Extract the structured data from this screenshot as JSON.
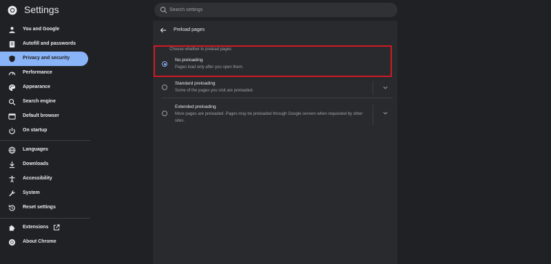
{
  "header": {
    "title": "Settings",
    "search_placeholder": "Search settings"
  },
  "sidebar": {
    "items": [
      {
        "label": "You and Google",
        "icon": "person-icon"
      },
      {
        "label": "Autofill and passwords",
        "icon": "autofill-icon"
      },
      {
        "label": "Privacy and security",
        "icon": "shield-icon",
        "active": true
      },
      {
        "label": "Performance",
        "icon": "speedometer-icon"
      },
      {
        "label": "Appearance",
        "icon": "palette-icon"
      },
      {
        "label": "Search engine",
        "icon": "search-icon"
      },
      {
        "label": "Default browser",
        "icon": "browser-icon"
      },
      {
        "label": "On startup",
        "icon": "power-icon"
      },
      {
        "label": "Languages",
        "icon": "globe-icon"
      },
      {
        "label": "Downloads",
        "icon": "download-icon"
      },
      {
        "label": "Accessibility",
        "icon": "accessibility-icon"
      },
      {
        "label": "System",
        "icon": "wrench-icon"
      },
      {
        "label": "Reset settings",
        "icon": "reset-icon"
      },
      {
        "label": "Extensions",
        "icon": "puzzle-icon"
      },
      {
        "label": "About Chrome",
        "icon": "chrome-icon"
      }
    ]
  },
  "main": {
    "title": "Preload pages",
    "section_label": "Choose whether to preload pages",
    "options": [
      {
        "title": "No preloading",
        "description": "Pages load only after you open them.",
        "selected": true
      },
      {
        "title": "Standard preloading",
        "description": "Some of the pages you visit are preloaded.",
        "selected": false
      },
      {
        "title": "Extended preloading",
        "description": "More pages are preloaded. Pages may be preloaded through Google servers when requested by other sites.",
        "selected": false
      }
    ]
  },
  "colors": {
    "accent": "#8ab4f8",
    "highlight": "#d11a24",
    "background": "#202124",
    "card": "#292a2d"
  }
}
